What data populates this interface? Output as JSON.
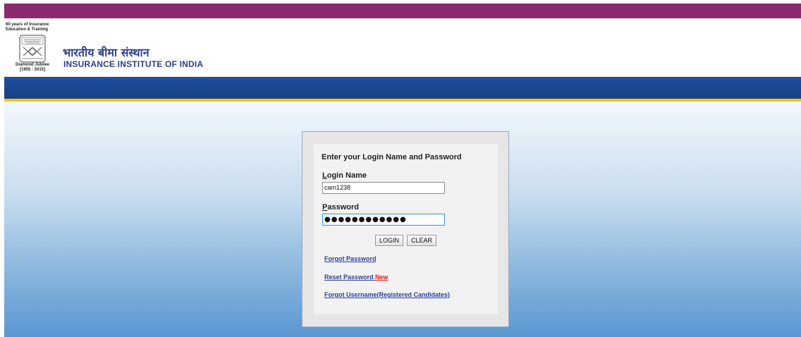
{
  "header": {
    "jubilee_top": "60 years of Insurance Education & Training",
    "seal_text": "भारतीय बीमा संस्थान INSURANCE INSTITUTE OF INDIA",
    "jubilee_title": "Diamond Jubilee",
    "jubilee_years": "[1955 - 2015]",
    "org_hindi": "भारतीय बीमा संस्थान",
    "org_english": "INSURANCE INSTITUTE OF INDIA"
  },
  "colors": {
    "top_strip": "#8b2a6e",
    "nav_bar": "#1f4f9e",
    "nav_stripe": "#f2c318",
    "brand_text": "#2b3f8a",
    "link": "#2a3f9e",
    "new_badge": "#e0231d"
  },
  "login": {
    "title": "Enter your Login Name and Password",
    "login_name_label_accesskey": "L",
    "login_name_label_rest": "ogin Name",
    "login_name_value": "cam1238",
    "password_label_accesskey": "P",
    "password_label_rest": "assword",
    "password_masked": "●●●●●●●●●●●●",
    "login_button": "LOGIN",
    "clear_button": "CLEAR"
  },
  "links": {
    "forgot_password": "Forgot Password",
    "reset_password": "Reset Password",
    "new_badge": "New",
    "forgot_username": "Forgot Username(Registered Candidates)"
  },
  "icons": {
    "seal": "institute-seal-icon"
  }
}
